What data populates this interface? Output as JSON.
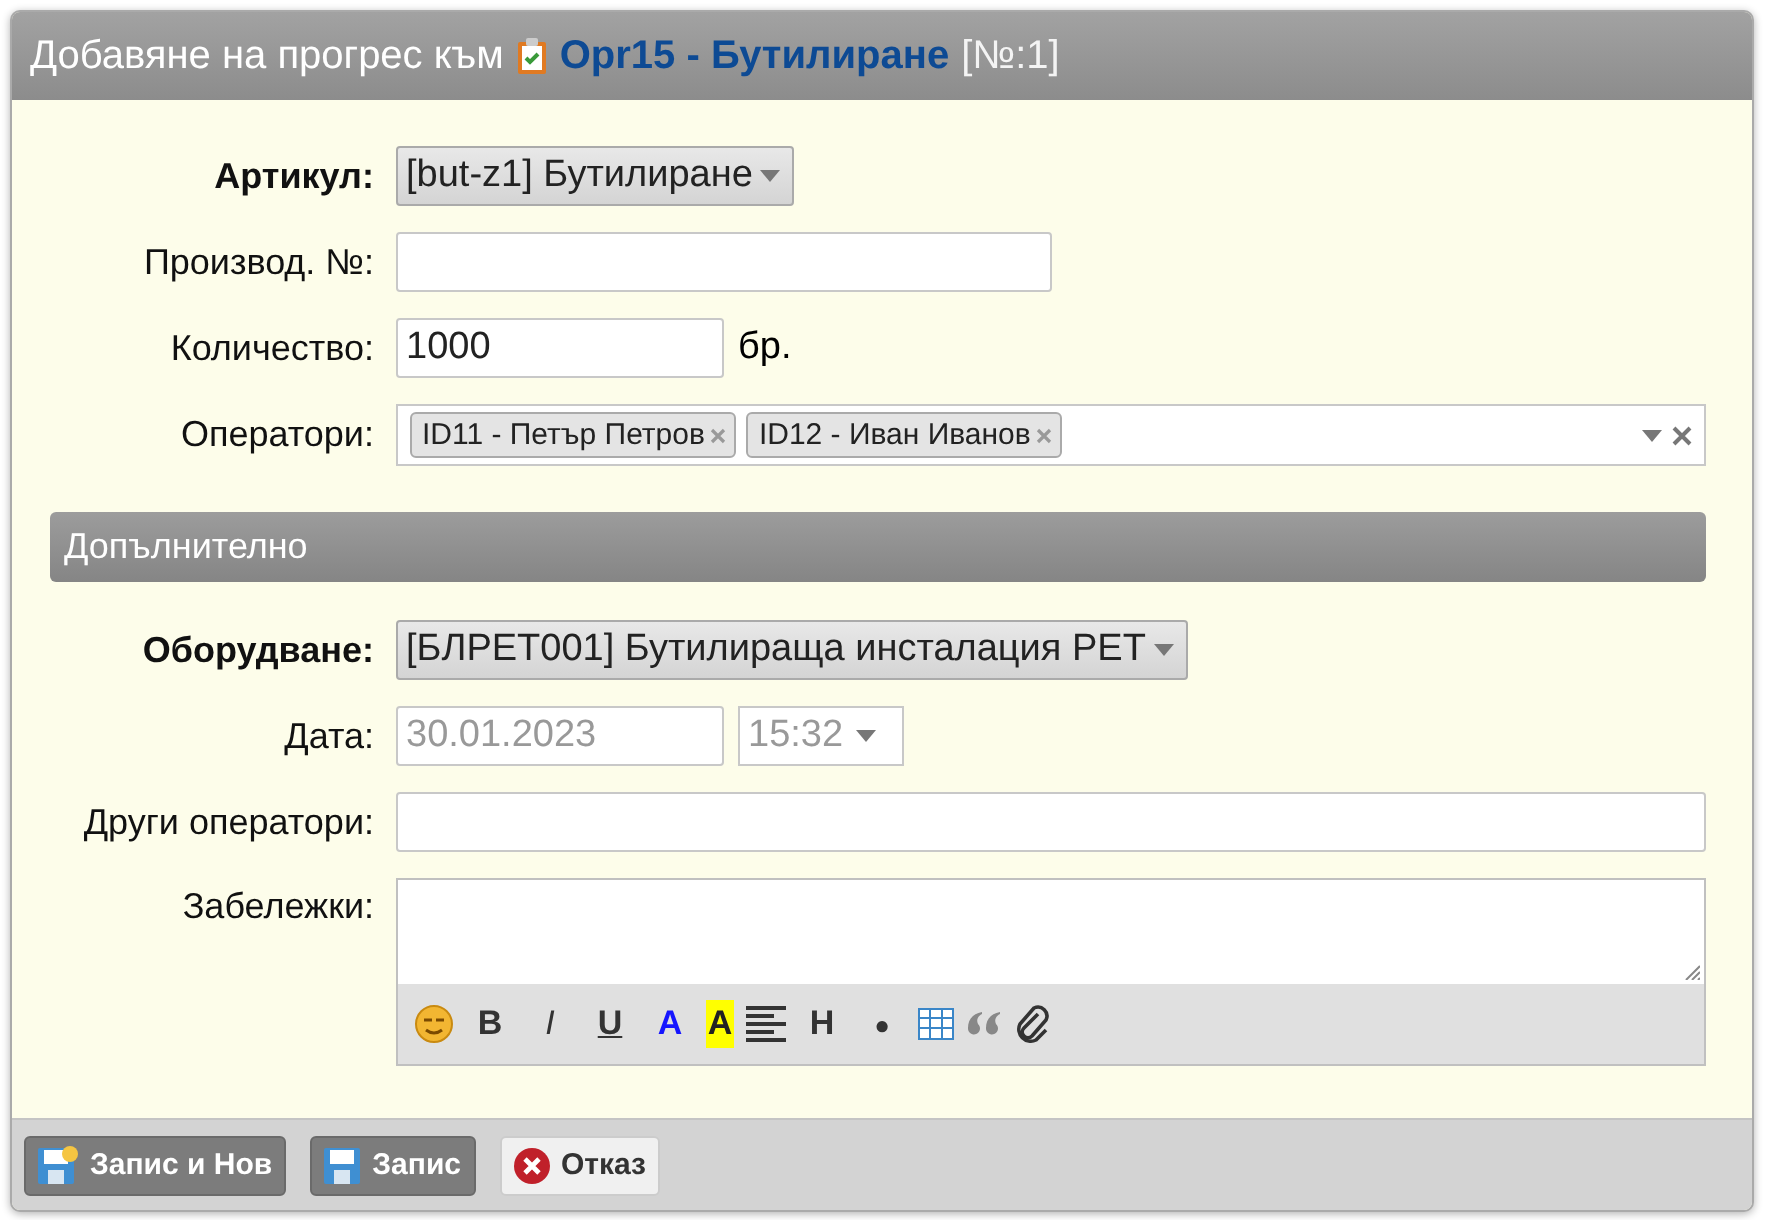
{
  "window": {
    "title": "Добавяне на прогрес към",
    "link": "Opr15 - Бутилиране",
    "suffix": "[№:1]"
  },
  "fields": [
    {
      "kind": "select",
      "label": "Артикул:",
      "bold": true,
      "value": "[but-z1] Бутилиране"
    },
    {
      "kind": "text",
      "label": "Производ. №:",
      "bold": false
    },
    {
      "kind": "number",
      "label": "Количество:",
      "bold": false,
      "value": "1000",
      "unit": "бр."
    },
    {
      "kind": "tags",
      "label": "Оператори:",
      "bold": false,
      "tags": [
        "ID11 - Петър Петров",
        "ID12 - Иван Иванов"
      ]
    }
  ],
  "section": {
    "title": "Допълнително"
  },
  "extra_fields": [
    {
      "kind": "select",
      "label": "Оборудване:",
      "bold": true,
      "value": "[БЛРЕТ001] Бутилираща инсталация PET"
    },
    {
      "kind": "datetime",
      "label": "Дата:",
      "bold": false,
      "date_placeholder": "30.01.2023",
      "time_placeholder": "15:32"
    },
    {
      "kind": "text",
      "label": "Други оператори:",
      "bold": false
    },
    {
      "kind": "richtext",
      "label": "Забележки:",
      "bold": false
    }
  ],
  "toolbar": [
    {
      "kind": "emoji"
    },
    {
      "kind": "bold",
      "label": "B"
    },
    {
      "kind": "italic",
      "label": "I"
    },
    {
      "kind": "underline",
      "label": "U"
    },
    {
      "kind": "color",
      "label": "A"
    },
    {
      "kind": "highlight",
      "label": "A"
    },
    {
      "kind": "align"
    },
    {
      "kind": "heading",
      "label": "H"
    },
    {
      "kind": "bullet",
      "label": "●"
    },
    {
      "kind": "table"
    },
    {
      "kind": "quote"
    },
    {
      "kind": "attach"
    }
  ],
  "buttons": [
    {
      "kind": "save_new",
      "label": "Запис и Нов"
    },
    {
      "kind": "save",
      "label": "Запис"
    },
    {
      "kind": "cancel",
      "label": "Отказ"
    }
  ]
}
